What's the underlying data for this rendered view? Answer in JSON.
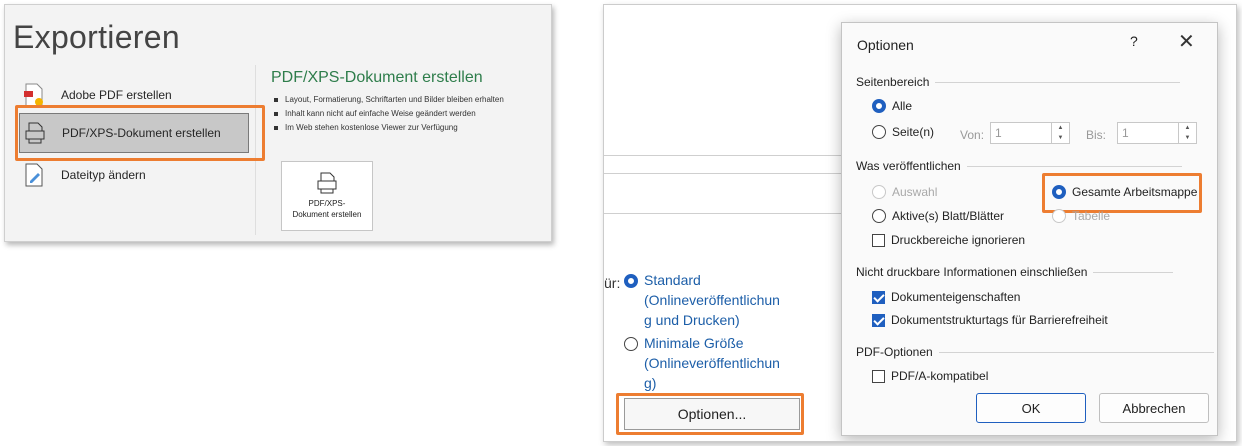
{
  "left": {
    "title": "Exportieren",
    "items": [
      {
        "label": "Adobe PDF erstellen"
      },
      {
        "label": "PDF/XPS-Dokument erstellen"
      },
      {
        "label": "Dateityp ändern"
      }
    ],
    "section_title": "PDF/XPS-Dokument erstellen",
    "bullets": [
      "Layout, Formatierung, Schriftarten und Bilder bleiben erhalten",
      "Inhalt kann nicht auf einfache Weise geändert werden",
      "Im Web stehen kostenlose Viewer zur Verfügung"
    ],
    "big_button_line1": "PDF/XPS-",
    "big_button_line2": "Dokument erstellen"
  },
  "right": {
    "optimize_label": "ür:",
    "standard_line1": "Standard",
    "standard_line2": "(Onlineveröffentlichun",
    "standard_line3": "g und Drucken)",
    "minimal_line1": "Minimale Größe",
    "minimal_line2": "(Onlineveröffentlichun",
    "minimal_line3": "g)",
    "options_button": "Optionen..."
  },
  "dialog": {
    "title": "Optionen",
    "help": "?",
    "close": "✕",
    "sections": {
      "range": "Seitenbereich",
      "publish": "Was veröffentlichen",
      "nonprint": "Nicht druckbare Informationen einschließen",
      "pdf": "PDF-Optionen"
    },
    "range": {
      "all": "Alle",
      "pages": "Seite(n)",
      "from_label": "Von:",
      "from_value": "1",
      "to_label": "Bis:",
      "to_value": "1"
    },
    "publish": {
      "selection": "Auswahl",
      "workbook": "Gesamte Arbeitsmappe",
      "active": "Aktive(s) Blatt/Blätter",
      "table": "Tabelle",
      "ignore": "Druckbereiche ignorieren"
    },
    "nonprint": {
      "props": "Dokumenteigenschaften",
      "tags": "Dokumentstrukturtags für Barrierefreiheit"
    },
    "pdf": {
      "pdfa": "PDF/A-kompatibel"
    },
    "ok": "OK",
    "cancel": "Abbrechen"
  },
  "colors": {
    "highlight": "#ed7d31",
    "accent": "#1f5fbf",
    "title_green": "#2e7d4b"
  }
}
